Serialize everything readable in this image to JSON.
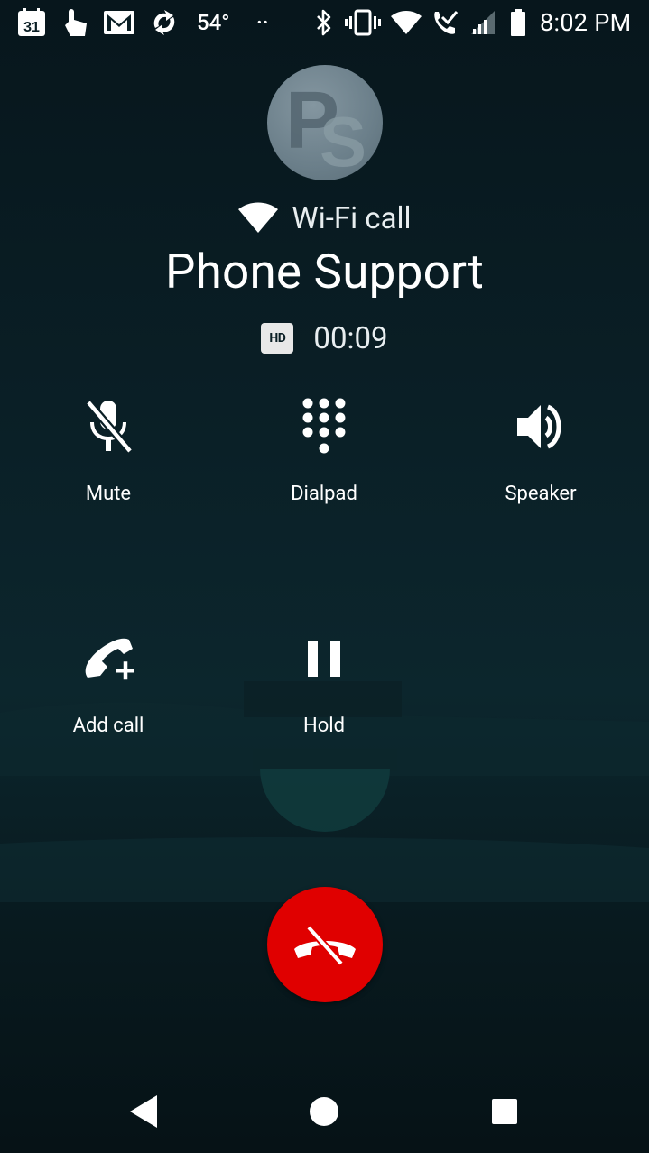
{
  "status_bar": {
    "calendar_day": "31",
    "temperature": "54°",
    "overflow": "··",
    "time": "8:02 PM"
  },
  "call": {
    "type_label": "Wi-Fi call",
    "caller_name": "Phone Support",
    "hd_badge": "HD",
    "duration": "00:09"
  },
  "controls": {
    "mute": "Mute",
    "dialpad": "Dialpad",
    "speaker": "Speaker",
    "add_call": "Add call",
    "hold": "Hold"
  },
  "colors": {
    "end_call": "#e00000",
    "background": "#0a1f26"
  }
}
